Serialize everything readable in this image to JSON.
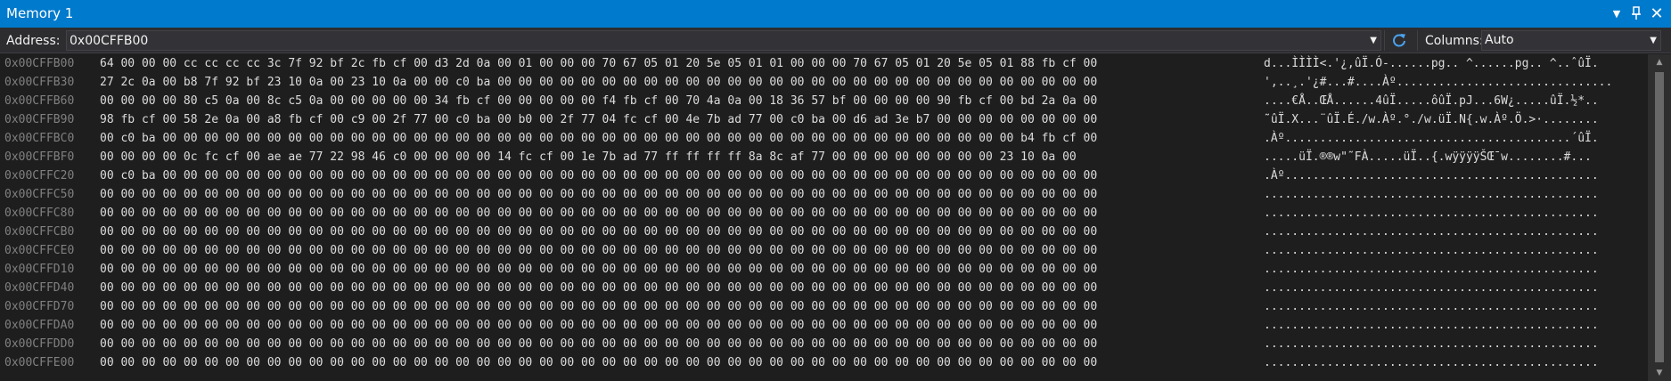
{
  "window": {
    "title": "Memory 1"
  },
  "toolbar": {
    "address_label": "Address:",
    "address_value": "0x00CFFB00",
    "columns_label": "Columns:",
    "columns_value": "Auto"
  },
  "rows": [
    {
      "address": "0x00CFFB00",
      "hex": "64 00 00 00 cc cc cc cc 3c 7f 92 bf 2c fb cf 00 d3 2d 0a 00 01 00 00 00 70 67 05 01 20 5e 05 01 01 00 00 00 70 67 05 01 20 5e 05 01 88 fb cf 00",
      "ascii": "d...ÌÌÌÌ<.'¿,ûÏ.Ó-......pg.. ^......pg.. ^..ˆûÏ."
    },
    {
      "address": "0x00CFFB30",
      "hex": "27 2c 0a 00 b8 7f 92 bf 23 10 0a 00 23 10 0a 00 00 c0 ba 00 00 00 00 00 00 00 00 00 00 00 00 00 00 00 00 00 00 00 00 00 00 00 00 00 00 00 00 00",
      "ascii": "',..¸.'¿#...#....Àº..............................."
    },
    {
      "address": "0x00CFFB60",
      "hex": "00 00 00 00 80 c5 0a 00 8c c5 0a 00 00 00 00 00 34 fb cf 00 00 00 00 00 f4 fb cf 00 70 4a 0a 00 18 36 57 bf 00 00 00 00 90 fb cf 00 bd 2a 0a 00",
      "ascii": "....€Å..ŒÅ......4ûÏ.....ôûÏ.pJ...6W¿.....ûÏ.½*.."
    },
    {
      "address": "0x00CFFB90",
      "hex": "98 fb cf 00 58 2e 0a 00 a8 fb cf 00 c9 00 2f 77 00 c0 ba 00 b0 00 2f 77 04 fc cf 00 4e 7b ad 77 00 c0 ba 00 d6 ad 3e b7 00 00 00 00 00 00 00 00",
      "ascii": "˜ûÏ.X...¨ûÏ.É./w.Àº.°./w.üÏ.N{.w.Àº.Ö.>·........"
    },
    {
      "address": "0x00CFFBC0",
      "hex": "00 c0 ba 00 00 00 00 00 00 00 00 00 00 00 00 00 00 00 00 00 00 00 00 00 00 00 00 00 00 00 00 00 00 00 00 00 00 00 00 00 00 00 00 00 b4 fb cf 00",
      "ascii": ".Àº.........................................´ûÏ."
    },
    {
      "address": "0x00CFFBF0",
      "hex": "00 00 00 00 0c fc cf 00 ae ae 77 22 98 46 c0 00 00 00 00 14 fc cf 00 1e 7b ad 77 ff ff ff ff 8a 8c af 77 00 00 00 00 00 00 00 00 23 10 0a 00",
      "ascii": ".....üÏ.®®w\"˜FÀ.....üÏ..{.wÿÿÿÿŠŒ¯w........#..."
    },
    {
      "address": "0x00CFFC20",
      "hex": "00 c0 ba 00 00 00 00 00 00 00 00 00 00 00 00 00 00 00 00 00 00 00 00 00 00 00 00 00 00 00 00 00 00 00 00 00 00 00 00 00 00 00 00 00 00 00 00 00",
      "ascii": ".Àº............................................."
    },
    {
      "address": "0x00CFFC50",
      "hex": "00 00 00 00 00 00 00 00 00 00 00 00 00 00 00 00 00 00 00 00 00 00 00 00 00 00 00 00 00 00 00 00 00 00 00 00 00 00 00 00 00 00 00 00 00 00 00 00",
      "ascii": "................................................"
    },
    {
      "address": "0x00CFFC80",
      "hex": "00 00 00 00 00 00 00 00 00 00 00 00 00 00 00 00 00 00 00 00 00 00 00 00 00 00 00 00 00 00 00 00 00 00 00 00 00 00 00 00 00 00 00 00 00 00 00 00",
      "ascii": "................................................"
    },
    {
      "address": "0x00CFFCB0",
      "hex": "00 00 00 00 00 00 00 00 00 00 00 00 00 00 00 00 00 00 00 00 00 00 00 00 00 00 00 00 00 00 00 00 00 00 00 00 00 00 00 00 00 00 00 00 00 00 00 00",
      "ascii": "................................................"
    },
    {
      "address": "0x00CFFCE0",
      "hex": "00 00 00 00 00 00 00 00 00 00 00 00 00 00 00 00 00 00 00 00 00 00 00 00 00 00 00 00 00 00 00 00 00 00 00 00 00 00 00 00 00 00 00 00 00 00 00 00",
      "ascii": "................................................"
    },
    {
      "address": "0x00CFFD10",
      "hex": "00 00 00 00 00 00 00 00 00 00 00 00 00 00 00 00 00 00 00 00 00 00 00 00 00 00 00 00 00 00 00 00 00 00 00 00 00 00 00 00 00 00 00 00 00 00 00 00",
      "ascii": "................................................"
    },
    {
      "address": "0x00CFFD40",
      "hex": "00 00 00 00 00 00 00 00 00 00 00 00 00 00 00 00 00 00 00 00 00 00 00 00 00 00 00 00 00 00 00 00 00 00 00 00 00 00 00 00 00 00 00 00 00 00 00 00",
      "ascii": "................................................"
    },
    {
      "address": "0x00CFFD70",
      "hex": "00 00 00 00 00 00 00 00 00 00 00 00 00 00 00 00 00 00 00 00 00 00 00 00 00 00 00 00 00 00 00 00 00 00 00 00 00 00 00 00 00 00 00 00 00 00 00 00",
      "ascii": "................................................"
    },
    {
      "address": "0x00CFFDA0",
      "hex": "00 00 00 00 00 00 00 00 00 00 00 00 00 00 00 00 00 00 00 00 00 00 00 00 00 00 00 00 00 00 00 00 00 00 00 00 00 00 00 00 00 00 00 00 00 00 00 00",
      "ascii": "................................................"
    },
    {
      "address": "0x00CFFDD0",
      "hex": "00 00 00 00 00 00 00 00 00 00 00 00 00 00 00 00 00 00 00 00 00 00 00 00 00 00 00 00 00 00 00 00 00 00 00 00 00 00 00 00 00 00 00 00 00 00 00 00",
      "ascii": "................................................"
    },
    {
      "address": "0x00CFFE00",
      "hex": "00 00 00 00 00 00 00 00 00 00 00 00 00 00 00 00 00 00 00 00 00 00 00 00 00 00 00 00 00 00 00 00 00 00 00 00 00 00 00 00 00 00 00 00 00 00 00 00",
      "ascii": "................................................"
    }
  ],
  "icons": {
    "dropdown": "chevron-down-icon",
    "pin": "pin-icon",
    "close": "close-icon",
    "refresh": "refresh-icon"
  },
  "colors": {
    "titlebar": "#007acc",
    "background": "#1e1e1e",
    "address_text": "#808080",
    "data_text": "#dcdcdc",
    "refresh_icon": "#4aa3f0"
  }
}
